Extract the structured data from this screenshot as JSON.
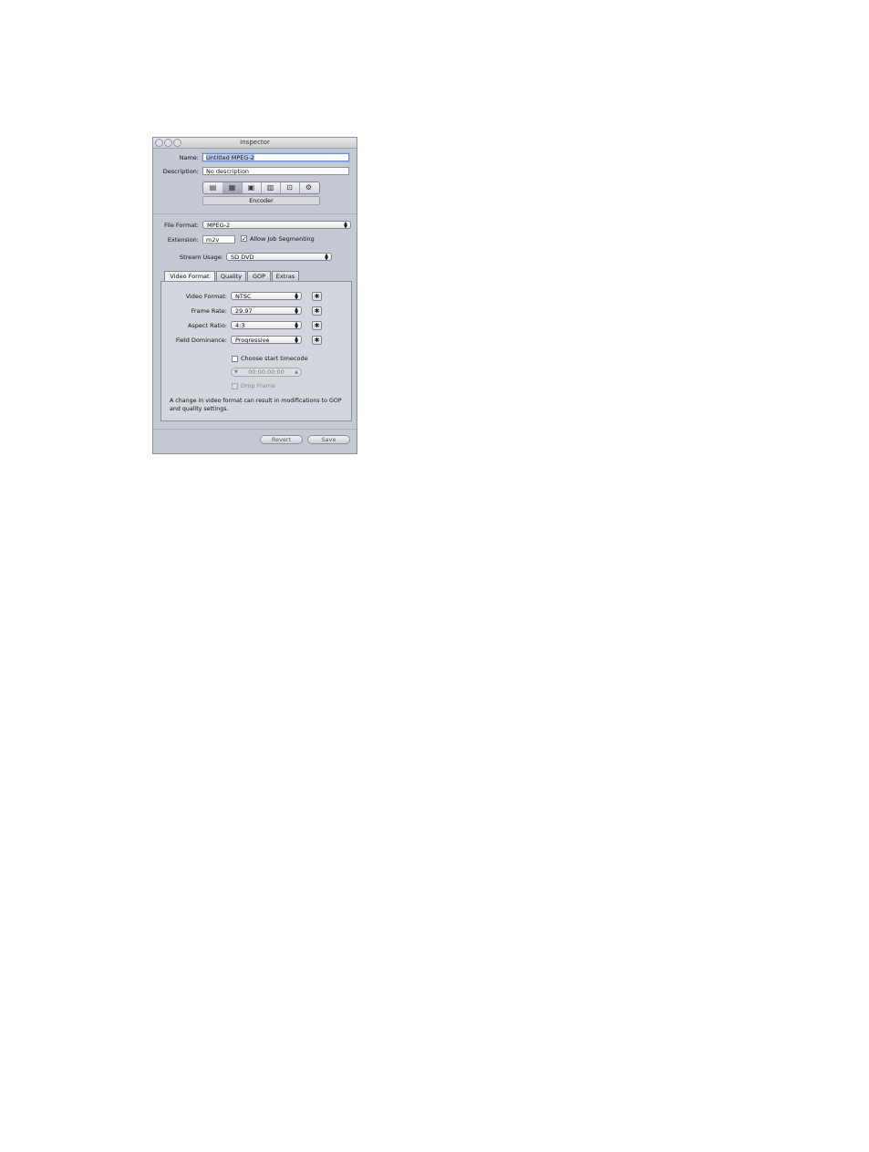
{
  "window": {
    "title": "Inspector"
  },
  "name": {
    "label": "Name:",
    "value": "Untitled MPEG-2"
  },
  "description": {
    "label": "Description:",
    "value": "No description"
  },
  "segments": {
    "icons": [
      "summary-icon",
      "encoder-icon",
      "frame-controls-icon",
      "filters-icon",
      "geometry-icon",
      "actions-icon"
    ],
    "selected_index": 1
  },
  "encoder_label": "Encoder",
  "file_format": {
    "label": "File Format:",
    "value": "MPEG-2"
  },
  "extension": {
    "label": "Extension:",
    "value": "m2v"
  },
  "allow_segmenting": {
    "label": "Allow Job Segmenting",
    "checked": true
  },
  "stream_usage": {
    "label": "Stream Usage:",
    "value": "SD DVD"
  },
  "tabs": [
    {
      "label": "Video Format",
      "active": true
    },
    {
      "label": "Quality",
      "active": false
    },
    {
      "label": "GOP",
      "active": false
    },
    {
      "label": "Extras",
      "active": false
    }
  ],
  "video": {
    "video_format": {
      "label": "Video Format:",
      "value": "NTSC"
    },
    "frame_rate": {
      "label": "Frame Rate:",
      "value": "29.97"
    },
    "aspect_ratio": {
      "label": "Aspect Ratio:",
      "value": "4:3"
    },
    "field_dominance": {
      "label": "Field Dominance:",
      "value": "Progressive"
    }
  },
  "start_timecode": {
    "label": "Choose start timecode",
    "value": "00:00:00:00"
  },
  "drop_frame": {
    "label": "Drop Frame"
  },
  "note": "A change in video format can result in modifications to GOP and quality settings.",
  "buttons": {
    "revert": "Revert",
    "save": "Save"
  }
}
